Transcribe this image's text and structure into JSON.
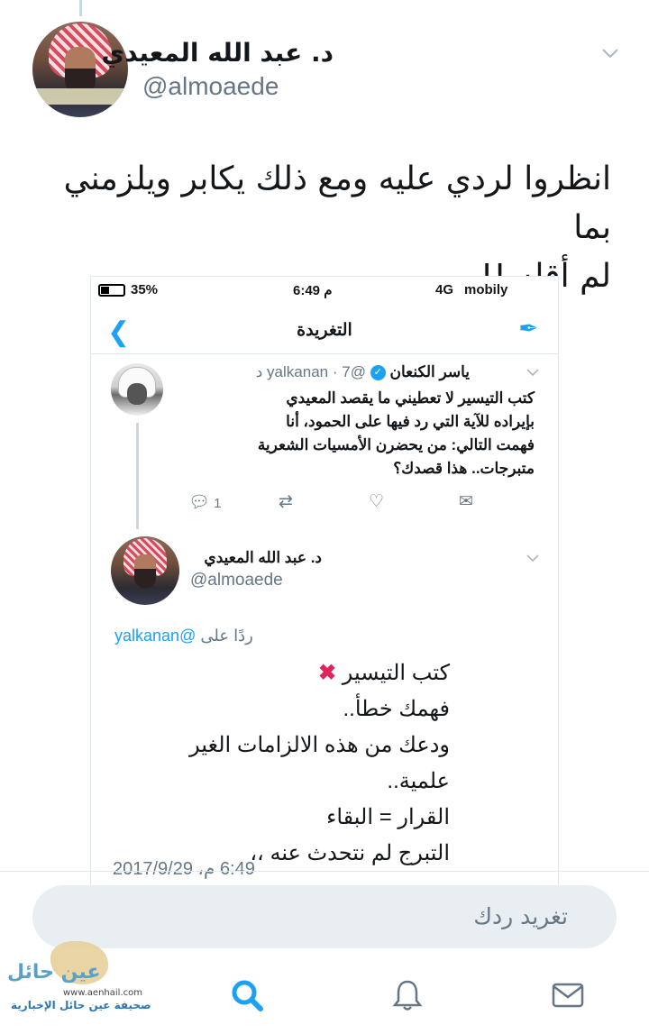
{
  "author": {
    "name": "د. عبد الله المعيدي",
    "handle": "@almoaede"
  },
  "tweet": {
    "text_line1": "انظروا لردي عليه ومع ذلك يكابر ويلزمني بما",
    "text_line2": "لم أقله !!"
  },
  "screenshot": {
    "status_bar": {
      "battery": "35%",
      "time": "6:49 م",
      "network": "4G",
      "carrier": "mobily"
    },
    "nav": {
      "title": "التغريدة"
    },
    "quoted": {
      "name": "ياسر الكنعان",
      "handle": "@yalkanan",
      "age": "7 د",
      "lines": [
        "كتب التيسير لا تعطيني ما يقصد المعيدي",
        "بإيراده للآية التي رد فيها على الحمود، أنا",
        "فهمت التالي: من يحضرن الأمسيات الشعرية",
        "متبرجات.. هذا قصدك؟"
      ],
      "reply_count": "1"
    },
    "reply": {
      "name": "د. عبد الله المعيدي",
      "handle": "@almoaede",
      "replying_prefix": "ردًا على",
      "replying_to": "@yalkanan",
      "lines": [
        "كتب التيسير",
        "فهمك خطأ..",
        "ودعك من هذه الالزامات الغير علمية..",
        "القرار = البقاء",
        "التبرج لم نتحدث عنه ،،"
      ],
      "date": "6:49 م، 2017/9/29"
    }
  },
  "reply_bar": {
    "placeholder": "تغريد ردك"
  },
  "tabs": [
    "home",
    "search",
    "notifications",
    "messages"
  ],
  "watermark": {
    "title": "عين حائل",
    "site": "www.aenhail.com",
    "subtitle": "صحيفة عين حائل الإخبارية"
  },
  "colors": {
    "accent": "#1da1f2",
    "muted": "#657786",
    "xmark": "#e0245e"
  }
}
